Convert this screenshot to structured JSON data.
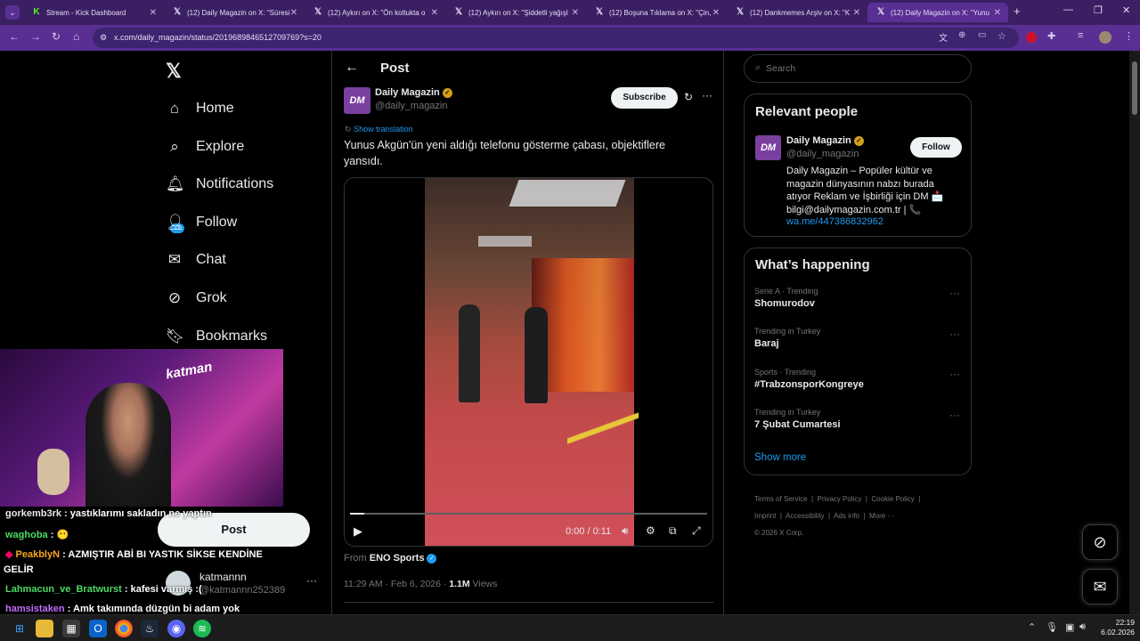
{
  "browser": {
    "tabs": [
      {
        "title": "Stream - Kick Dashboard",
        "icon": "kick-icon",
        "active": false
      },
      {
        "title": "(12) Daily Magazin on X: \"Süresi",
        "icon": "x-logo-icon",
        "active": false
      },
      {
        "title": "(12) Aykırı on X: \"Ön koltukta o",
        "icon": "x-logo-icon",
        "active": false
      },
      {
        "title": "(12) Aykırı on X: \"Şiddetli yağışl",
        "icon": "x-logo-icon",
        "active": false
      },
      {
        "title": "(12) Boşuna Tıklama on X: \"Çin,",
        "icon": "x-logo-icon",
        "active": false
      },
      {
        "title": "(12) Dankmemes Arşiv on X: \"K",
        "icon": "x-logo-icon",
        "active": false
      },
      {
        "title": "(12) Daily Magazin on X: \"Yunu",
        "icon": "x-logo-icon",
        "active": true
      }
    ],
    "url": "x.com/daily_magazin/status/2019689846512709769?s=20"
  },
  "nav": {
    "home": "Home",
    "explore": "Explore",
    "notifications": "Notifications",
    "notifications_badge": "12",
    "follow": "Follow",
    "chat": "Chat",
    "grok": "Grok",
    "bookmarks": "Bookmarks",
    "post_button": "Post",
    "account_name": "katmannn",
    "account_handle": "@katmannn252389"
  },
  "main": {
    "header_title": "Post",
    "author_name": "Daily Magazin",
    "author_handle": "@daily_magazin",
    "avatar_text": "DM",
    "subscribe_label": "Subscribe",
    "show_translation": "Show translation",
    "tweet_text": "Yunus Akgün'ün yeni aldığı telefonu gösterme çabası, objektiflere yansıdı.",
    "video_time": "0:00 / 0:11",
    "video_progress": 0.04,
    "from_label": "From",
    "from_source": "ENO Sports",
    "timestamp": "11:29 AM · Feb 6, 2026 · ",
    "views_count": "1.1M",
    "views_label": " Views"
  },
  "sidebar": {
    "search_placeholder": "Search",
    "relevant_title": "Relevant people",
    "person_name": "Daily Magazin",
    "person_handle": "@daily_magazin",
    "follow_label": "Follow",
    "person_bio": "Daily Magazin – Popüler kültür ve magazin dünyasının nabzı burada atıyor Reklam ve İşbirliği için DM 📩 bilgi@dailymagazin.com.tr | 📞",
    "person_link": "wa.me/447386832962",
    "happening_title": "What’s happening",
    "trends": [
      {
        "category": "Serie A · Trending",
        "name": "Shomurodov"
      },
      {
        "category": "Trending in Turkey",
        "name": "Baraj"
      },
      {
        "category": "Sports · Trending",
        "name": "#TrabzonsporKongreye"
      },
      {
        "category": "Trending in Turkey",
        "name": "7 Şubat Cumartesi"
      }
    ],
    "show_more": "Show more",
    "footer": {
      "terms": "Terms of Service",
      "privacy": "Privacy Policy",
      "cookie": "Cookie Policy",
      "imprint": "Imprint",
      "accessibility": "Accessibility",
      "ads": "Ads info",
      "more": "More ···",
      "copyright": "© 2026 X Corp."
    }
  },
  "stream_overlay": {
    "streamer_logo": "katman",
    "chat": [
      {
        "user": "gorkemb3rk",
        "color": "#e7e7e7",
        "message": " : yastıklarımı sakladın ne yaptın"
      },
      {
        "user": "waghoba",
        "color": "#4cd964",
        "message": " : 😶"
      },
      {
        "user": "PeakblyN",
        "color": "#f5a623",
        "message": " : AZMIŞTIR ABİ BI YASTIK SİKSE KENDİNE"
      },
      {
        "user": "",
        "color": "#ffffff",
        "message": "GELİR"
      },
      {
        "user": "Lahmacun_ve_Bratwurst",
        "color": "#4cd964",
        "message": " : kafesi varmış :("
      },
      {
        "user": "hamsistaken",
        "color": "#c36cff",
        "message": " : Amk takımında düzgün bi adam yok"
      }
    ]
  },
  "taskbar": {
    "time": "22:19",
    "date": "6.02.2026"
  },
  "colors": {
    "browser_tab_bg": "#3b1f63",
    "browser_toolbar_bg": "#5a2f93",
    "x_blue": "#1d9bf0",
    "border": "#2f3336"
  }
}
